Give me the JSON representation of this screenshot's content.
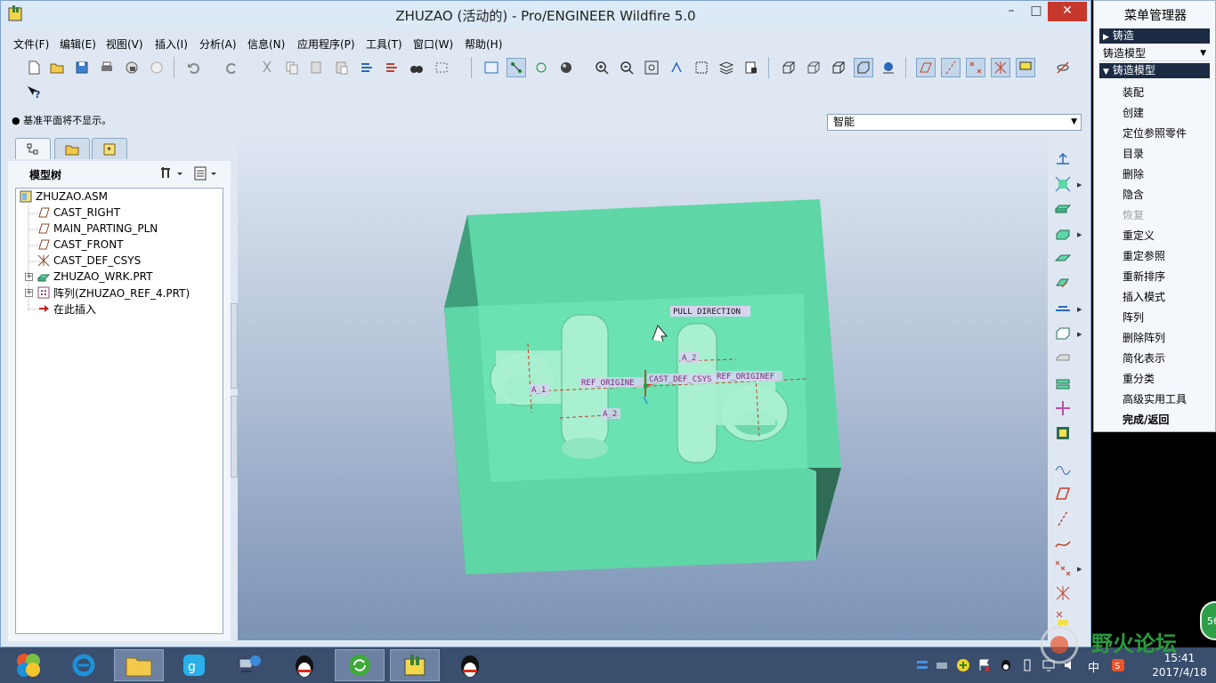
{
  "window": {
    "title": "ZHUZAO (活动的) - Pro/ENGINEER Wildfire 5.0",
    "minimize": "–",
    "maximize": "□",
    "close": "✕"
  },
  "menu": [
    "文件(F)",
    "编辑(E)",
    "视图(V)",
    "插入(I)",
    "分析(A)",
    "信息(N)",
    "应用程序(P)",
    "工具(T)",
    "窗口(W)",
    "帮助(H)"
  ],
  "message": "基准平面将不显示。",
  "filter": {
    "value": "智能"
  },
  "navigator": {
    "title": "模型树",
    "tree": [
      {
        "label": "ZHUZAO.ASM",
        "icon": "assembly-icon"
      },
      {
        "label": "CAST_RIGHT",
        "icon": "datum-plane-icon"
      },
      {
        "label": "MAIN_PARTING_PLN",
        "icon": "datum-plane-icon"
      },
      {
        "label": "CAST_FRONT",
        "icon": "datum-plane-icon"
      },
      {
        "label": "CAST_DEF_CSYS",
        "icon": "csys-icon"
      },
      {
        "label": "ZHUZAO_WRK.PRT",
        "icon": "workpiece-icon"
      },
      {
        "label": "阵列(ZHUZAO_REF_4.PRT)",
        "icon": "pattern-icon"
      },
      {
        "label": "在此插入",
        "icon": "insert-arrow-icon"
      }
    ]
  },
  "graphics": {
    "annotations": {
      "pull_direction": "PULL DIRECTION",
      "ref_origin_left": "REF_ORIGINE",
      "ref_origin_right": "REF_ORIGINEF",
      "cast_def_csys": "CAST_DEF_CSYS",
      "axis_a1": "A_1",
      "axis_a2_bottom": "A_2",
      "axis_a2_top": "A_2"
    }
  },
  "menu_manager": {
    "title": "菜单管理器",
    "header1": "铸造",
    "dropdown": "铸造模型",
    "header2": "铸造模型",
    "items": [
      {
        "label": "装配",
        "enabled": true
      },
      {
        "label": "创建",
        "enabled": true
      },
      {
        "label": "定位参照零件",
        "enabled": true
      },
      {
        "label": "目录",
        "enabled": true
      },
      {
        "label": "删除",
        "enabled": true
      },
      {
        "label": "隐含",
        "enabled": true
      },
      {
        "label": "恢复",
        "enabled": false
      },
      {
        "label": "重定义",
        "enabled": true
      },
      {
        "label": "重定参照",
        "enabled": true
      },
      {
        "label": "重新排序",
        "enabled": true
      },
      {
        "label": "插入模式",
        "enabled": true
      },
      {
        "label": "阵列",
        "enabled": true
      },
      {
        "label": "删除阵列",
        "enabled": true
      },
      {
        "label": "简化表示",
        "enabled": true
      },
      {
        "label": "重分类",
        "enabled": true
      },
      {
        "label": "高级实用工具",
        "enabled": true
      }
    ],
    "done": "完成/返回"
  },
  "taskbar": {
    "ime": "中",
    "time": "15:41",
    "date": "2017/4/18"
  },
  "watermark": {
    "text": "野火论坛",
    "badge": "56"
  },
  "colors": {
    "mold_front": "#5ed6a6",
    "mold_side": "#2f6b55",
    "accent_red": "#c7382c"
  }
}
